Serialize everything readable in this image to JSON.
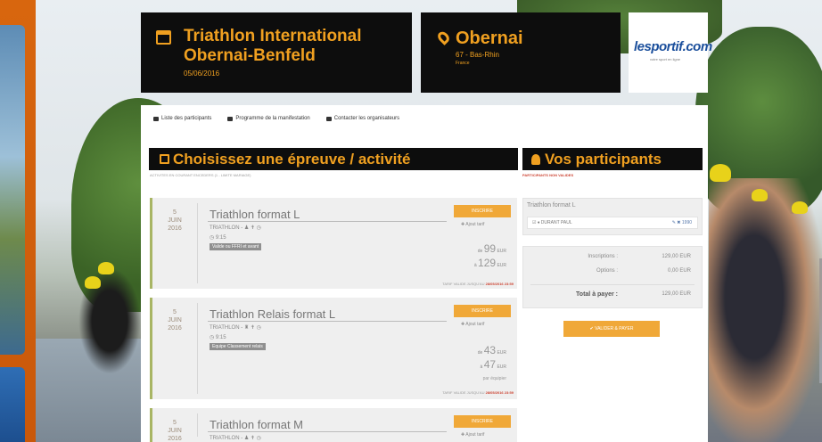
{
  "event": {
    "title": "Triathlon International Obernai-Benfeld",
    "date": "05/06/2016"
  },
  "location": {
    "city": "Obernai",
    "department": "67 - Bas-Rhin",
    "country": "France"
  },
  "sponsor": {
    "logo_text": "lesportif.com",
    "tagline": "votre sport en ligne"
  },
  "nav": {
    "items": [
      {
        "label": "Liste des participants",
        "icon": "list-icon"
      },
      {
        "label": "Programme de la manifestation",
        "icon": "calendar-icon"
      },
      {
        "label": "Contacter les organisateurs",
        "icon": "envelope-icon"
      }
    ]
  },
  "events_section": {
    "header": "Choisissez une épreuve / activité",
    "subtext": "ACTIVITES EN COURANT ENCEDERS (1 - LIMITE MARIAGE)"
  },
  "participants_section": {
    "header": "Vos participants",
    "subtext": "PARTICIPANTS NON VALIDES"
  },
  "cards": [
    {
      "day": "5",
      "month": "JUIN",
      "year": "2016",
      "title": "Triathlon format L",
      "category": "TRIATHLON - ♟ ✝ ◷",
      "time": "◷ 9:15",
      "tag": "Valide ou FFRI et avant",
      "button_label": "INSCRIRE",
      "cart_label": "✚ Ajout tarif",
      "price_low": "99",
      "price_high": "129",
      "currency": "EUR",
      "per_person": "",
      "tarif_label": "TARIF VALIDE JUSQU'AU",
      "tarif_date": "28/05/2016 23:59"
    },
    {
      "day": "5",
      "month": "JUIN",
      "year": "2016",
      "title": "Triathlon Relais format L",
      "category": "TRIATHLON - ♜ ✝ ◷",
      "time": "◷ 9:15",
      "tag": "Equipe Classement relais",
      "button_label": "INSCRIRE",
      "cart_label": "✚ Ajout tarif",
      "price_low": "43",
      "price_high": "47",
      "currency": "EUR",
      "per_person": "par équipier",
      "tarif_label": "TARIF VALIDE JUSQU'AU",
      "tarif_date": "28/05/2016 23:59"
    },
    {
      "day": "5",
      "month": "JUIN",
      "year": "2016",
      "title": "Triathlon format M",
      "category": "TRIATHLON - ♟ ✝ ◷",
      "time": "",
      "tag": "",
      "button_label": "INSCRIRE",
      "cart_label": "✚ Ajout tarif",
      "price_low": "",
      "price_high": "",
      "currency": "",
      "per_person": "",
      "tarif_label": "",
      "tarif_date": ""
    }
  ],
  "cart": {
    "event_title": "Triathlon format L",
    "participant_name": "☑ ♦ DURANT PAUL",
    "participant_actions": "✎ ✖   1990",
    "lines": [
      {
        "label": "Inscriptions :",
        "value": "129,00 EUR"
      },
      {
        "label": "Options :",
        "value": "0,00 EUR"
      }
    ],
    "total_label": "Total à payer :",
    "total_value": "129,00 EUR",
    "submit_label": "✔ VALIDER & PAYER"
  },
  "colors": {
    "accent": "#f0a020",
    "frame": "#d8660e",
    "button": "#f0a838",
    "header_bg": "#0d0d0d"
  }
}
